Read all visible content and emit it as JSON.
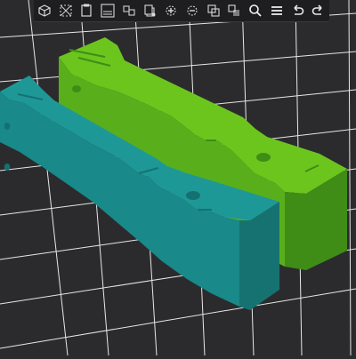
{
  "app": {
    "window_title": ""
  },
  "toolbar": {
    "items": [
      {
        "name": "add-cube-icon",
        "label": ""
      },
      {
        "name": "wireframe-icon",
        "label": ""
      },
      {
        "name": "paste-icon",
        "label": ""
      },
      {
        "name": "copy-icon",
        "label": ""
      },
      {
        "name": "arrange-icon",
        "label": ""
      },
      {
        "name": "duplicate-icon",
        "label": ""
      },
      {
        "name": "add-instance-icon",
        "label": ""
      },
      {
        "name": "remove-instance-icon",
        "label": ""
      },
      {
        "name": "split-objects-icon",
        "label": ""
      },
      {
        "name": "split-parts-icon",
        "label": ""
      },
      {
        "name": "search-icon",
        "label": ""
      },
      {
        "name": "list-icon",
        "label": ""
      },
      {
        "name": "undo-icon",
        "label": ""
      },
      {
        "name": "redo-icon",
        "label": ""
      }
    ]
  },
  "scene": {
    "background_color": "#2b2b2d",
    "grid_color": "#f2f2f2",
    "objects": [
      {
        "name": "green-block",
        "color": "#6cc51d",
        "shade_color": "#3f8d16"
      },
      {
        "name": "teal-block",
        "color": "#1e9897",
        "shade_color": "#167271"
      }
    ]
  }
}
